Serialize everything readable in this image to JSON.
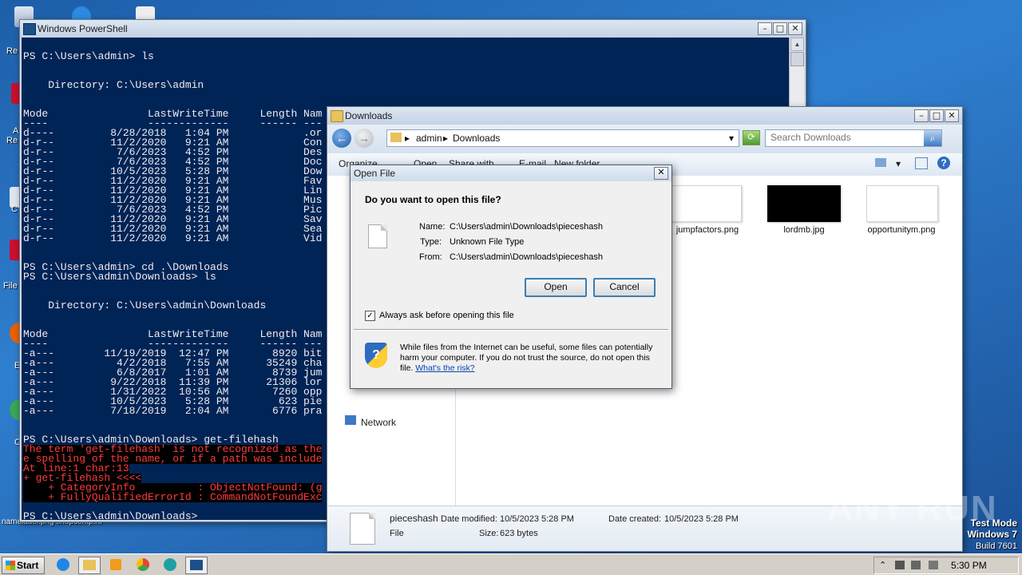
{
  "desktop": {
    "icon_labels": [
      "Re",
      "A",
      "Re",
      "C",
      "File",
      "E",
      "C",
      "nameladel.png snopcentp.rtf"
    ],
    "os_info": [
      "Test Mode",
      "Windows 7",
      "Build 7601"
    ],
    "watermark": "ANY RUN"
  },
  "powershell": {
    "title": "Windows PowerShell",
    "lines": [
      {
        "text": "PS C:\\Users\\admin> ls",
        "err": false
      },
      {
        "text": "",
        "err": false
      },
      {
        "text": "",
        "err": false
      },
      {
        "text": "    Directory: C:\\Users\\admin",
        "err": false
      },
      {
        "text": "",
        "err": false
      },
      {
        "text": "",
        "err": false
      },
      {
        "text": "Mode                LastWriteTime     Length Nam",
        "err": false
      },
      {
        "text": "----                -------------     ------ ---",
        "err": false
      },
      {
        "text": "d----         8/28/2018   1:04 PM            .or",
        "err": false
      },
      {
        "text": "d-r--         11/2/2020   9:21 AM            Con",
        "err": false
      },
      {
        "text": "d-r--          7/6/2023   4:52 PM            Des",
        "err": false
      },
      {
        "text": "d-r--          7/6/2023   4:52 PM            Doc",
        "err": false
      },
      {
        "text": "d-r--         10/5/2023   5:28 PM            Dow",
        "err": false
      },
      {
        "text": "d-r--         11/2/2020   9:21 AM            Fav",
        "err": false
      },
      {
        "text": "d-r--         11/2/2020   9:21 AM            Lin",
        "err": false
      },
      {
        "text": "d-r--         11/2/2020   9:21 AM            Mus",
        "err": false
      },
      {
        "text": "d-r--          7/6/2023   4:52 PM            Pic",
        "err": false
      },
      {
        "text": "d-r--         11/2/2020   9:21 AM            Sav",
        "err": false
      },
      {
        "text": "d-r--         11/2/2020   9:21 AM            Sea",
        "err": false
      },
      {
        "text": "d-r--         11/2/2020   9:21 AM            Vid",
        "err": false
      },
      {
        "text": "",
        "err": false
      },
      {
        "text": "",
        "err": false
      },
      {
        "text": "PS C:\\Users\\admin> cd .\\Downloads",
        "err": false
      },
      {
        "text": "PS C:\\Users\\admin\\Downloads> ls",
        "err": false
      },
      {
        "text": "",
        "err": false
      },
      {
        "text": "",
        "err": false
      },
      {
        "text": "    Directory: C:\\Users\\admin\\Downloads",
        "err": false
      },
      {
        "text": "",
        "err": false
      },
      {
        "text": "",
        "err": false
      },
      {
        "text": "Mode                LastWriteTime     Length Nam",
        "err": false
      },
      {
        "text": "----                -------------     ------ ---",
        "err": false
      },
      {
        "text": "-a---        11/19/2019  12:47 PM       8920 bit",
        "err": false
      },
      {
        "text": "-a---          4/2/2018   7:55 AM      35249 cha",
        "err": false
      },
      {
        "text": "-a---          6/8/2017   1:01 AM       8739 jum",
        "err": false
      },
      {
        "text": "-a---         9/22/2018  11:39 PM      21306 lor",
        "err": false
      },
      {
        "text": "-a---         1/31/2022  10:56 AM       7260 opp",
        "err": false
      },
      {
        "text": "-a---         10/5/2023   5:28 PM        623 pie",
        "err": false
      },
      {
        "text": "-a---         7/18/2019   2:04 AM       6776 pra",
        "err": false
      },
      {
        "text": "",
        "err": false
      },
      {
        "text": "",
        "err": false
      },
      {
        "text": "PS C:\\Users\\admin\\Downloads> get-filehash",
        "err": false
      },
      {
        "text": "The term 'get-filehash' is not recognized as the",
        "err": true
      },
      {
        "text": "e spelling of the name, or if a path was include",
        "err": true
      },
      {
        "text": "At line:1 char:13",
        "err": true
      },
      {
        "text": "+ get-filehash <<<<",
        "err": true
      },
      {
        "text": "    + CategoryInfo          : ObjectNotFound: (g",
        "err": true
      },
      {
        "text": "    + FullyQualifiedErrorId : CommandNotFoundExc",
        "err": true
      },
      {
        "text": "",
        "err": false
      },
      {
        "text": "PS C:\\Users\\admin\\Downloads>",
        "err": false
      }
    ]
  },
  "explorer": {
    "title": "Downloads",
    "breadcrumb": [
      "admin",
      "Downloads"
    ],
    "search_placeholder": "Search Downloads",
    "commands": [
      "Organize",
      "Open",
      "Share with",
      "E-mail",
      "New folder"
    ],
    "nav_items": [
      "Network"
    ],
    "files": [
      {
        "name": "jumpfactors.png",
        "dark": false
      },
      {
        "name": "lordmb.jpg",
        "dark": true
      },
      {
        "name": "opportunitym.png",
        "dark": false
      }
    ],
    "details": {
      "filename": "pieceshash",
      "type": "File",
      "modified_label": "Date modified:",
      "modified": "10/5/2023 5:28 PM",
      "created_label": "Date created:",
      "created": "10/5/2023 5:28 PM",
      "size_label": "Size:",
      "size": "623 bytes"
    }
  },
  "dialog": {
    "title": "Open File",
    "question": "Do you want to open this file?",
    "fields": [
      {
        "label": "Name:",
        "value": "C:\\Users\\admin\\Downloads\\pieceshash"
      },
      {
        "label": "Type:",
        "value": "Unknown File Type"
      },
      {
        "label": "From:",
        "value": "C:\\Users\\admin\\Downloads\\pieceshash"
      }
    ],
    "open_label": "Open",
    "cancel_label": "Cancel",
    "checkbox_label": "Always ask before opening this file",
    "checkbox_checked": true,
    "warning_text": "While files from the Internet can be useful, some files can potentially harm your computer. If you do not trust the source, do not open this file.",
    "risk_link": "What's the risk?"
  },
  "taskbar": {
    "start_label": "Start",
    "clock": "5:30 PM"
  }
}
